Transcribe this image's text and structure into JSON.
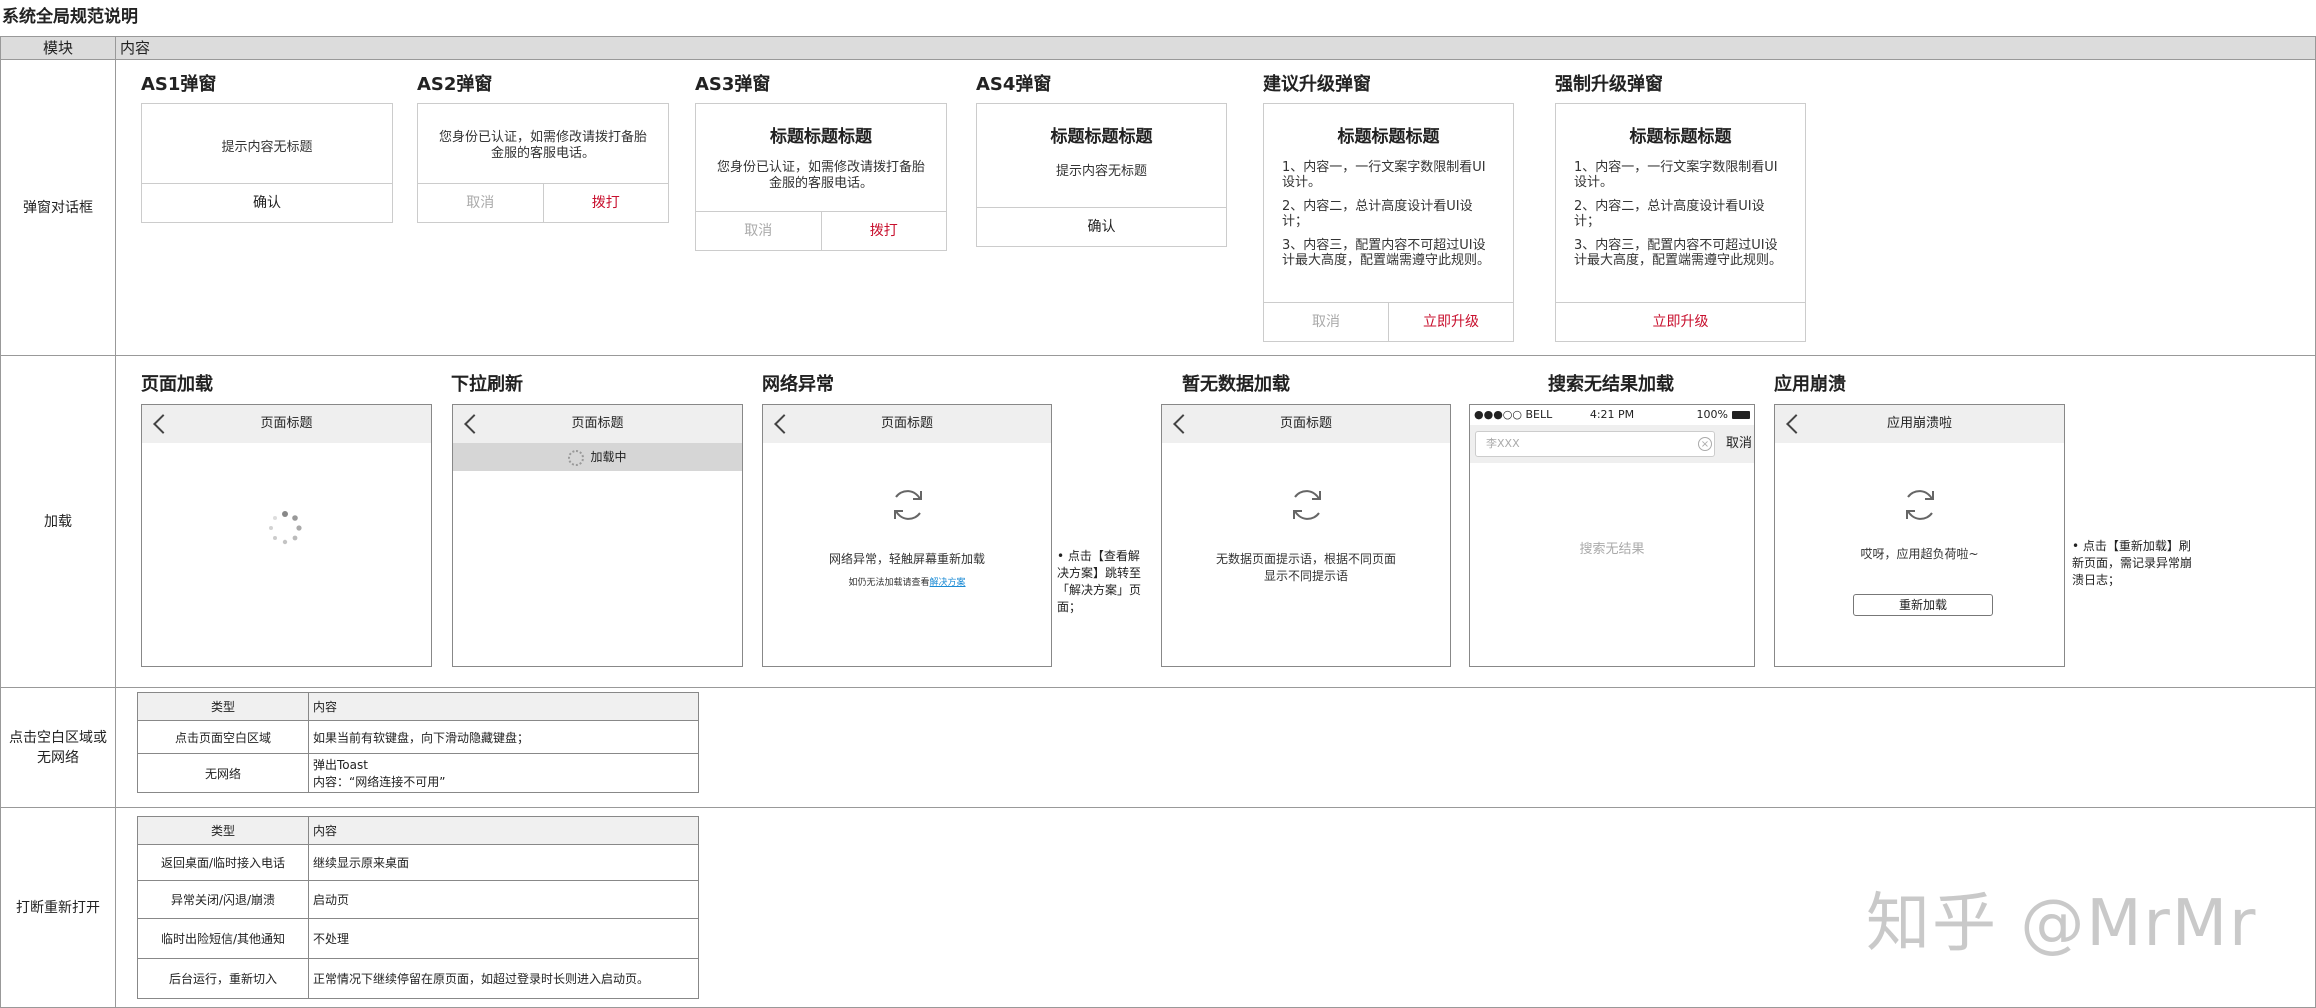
{
  "title": "系统全局规范说明",
  "header": {
    "col1": "模块",
    "col2": "内容"
  },
  "rows": {
    "dialog": "弹窗对话框",
    "loading": "加载",
    "blank": "点击空白区域或无网络",
    "interrupt": "打断重新打开"
  },
  "dialogs": {
    "as1": {
      "label": "AS1弹窗",
      "content": "提示内容无标题",
      "confirm": "确认"
    },
    "as2": {
      "label": "AS2弹窗",
      "content": "您身份已认证，如需修改请拨打备胎金服的客服电话。",
      "cancel": "取消",
      "call": "拨打"
    },
    "as3": {
      "label": "AS3弹窗",
      "title": "标题标题标题",
      "content": "您身份已认证，如需修改请拨打备胎金服的客服电话。",
      "cancel": "取消",
      "call": "拨打"
    },
    "as4": {
      "label": "AS4弹窗",
      "title": "标题标题标题",
      "content": "提示内容无标题",
      "confirm": "确认"
    },
    "suggest": {
      "label": "建议升级弹窗",
      "title": "标题标题标题",
      "items": [
        "1、内容一，一行文案字数限制看UI设计。",
        "2、内容二，总计高度设计看UI设计；",
        "3、内容三，配置内容不可超过UI设计最大高度，配置端需遵守此规则。"
      ],
      "cancel": "取消",
      "upgrade": "立即升级"
    },
    "force": {
      "label": "强制升级弹窗",
      "title": "标题标题标题",
      "items": [
        "1、内容一，一行文案字数限制看UI设计。",
        "2、内容二，总计高度设计看UI设计；",
        "3、内容三，配置内容不可超过UI设计最大高度，配置端需遵守此规则。"
      ],
      "upgrade": "立即升级"
    }
  },
  "loading": {
    "page": {
      "label": "页面加载",
      "nav": "页面标题"
    },
    "pull": {
      "label": "下拉刷新",
      "nav": "页面标题",
      "status": "加载中"
    },
    "network": {
      "label": "网络异常",
      "nav": "页面标题",
      "msg": "网络异常，轻触屏幕重新加载",
      "sub": "如仍无法加载请查看",
      "link": "解决方案",
      "note": "• 点击【查看解决方案】跳转至「解决方案」页面；"
    },
    "empty": {
      "label": "暂无数据加载",
      "nav": "页面标题",
      "msg": "无数据页面提示语，根据不同页面显示不同提示语"
    },
    "search": {
      "label": "搜索无结果加载",
      "carrier": "●●●○○ BELL",
      "time": "4:21 PM",
      "battery": "100%",
      "query": "李XXX",
      "cancel": "取消",
      "msg": "搜索无结果"
    },
    "crash": {
      "label": "应用崩溃",
      "nav": "应用崩溃啦",
      "msg": "哎呀，应用超负荷啦~",
      "button": "重新加载",
      "note": "• 点击【重新加载】刷新页面，需记录异常崩溃日志；"
    }
  },
  "blank_table": {
    "head": [
      "类型",
      "内容"
    ],
    "rows": [
      [
        "点击页面空白区域",
        "如果当前有软键盘，向下滑动隐藏键盘；"
      ],
      [
        "无网络",
        "弹出Toast",
        "内容：“网络连接不可用”"
      ]
    ]
  },
  "interrupt_table": {
    "head": [
      "类型",
      "内容"
    ],
    "rows": [
      [
        "返回桌面/临时接入电话",
        "继续显示原来桌面"
      ],
      [
        "异常关闭/闪退/崩溃",
        "启动页"
      ],
      [
        "临时出险短信/其他通知",
        "不处理"
      ],
      [
        "后台运行，重新切入",
        "正常情况下继续停留在原页面，如超过登录时长则进入启动页。"
      ]
    ]
  },
  "watermark": "知乎 @MrMr"
}
